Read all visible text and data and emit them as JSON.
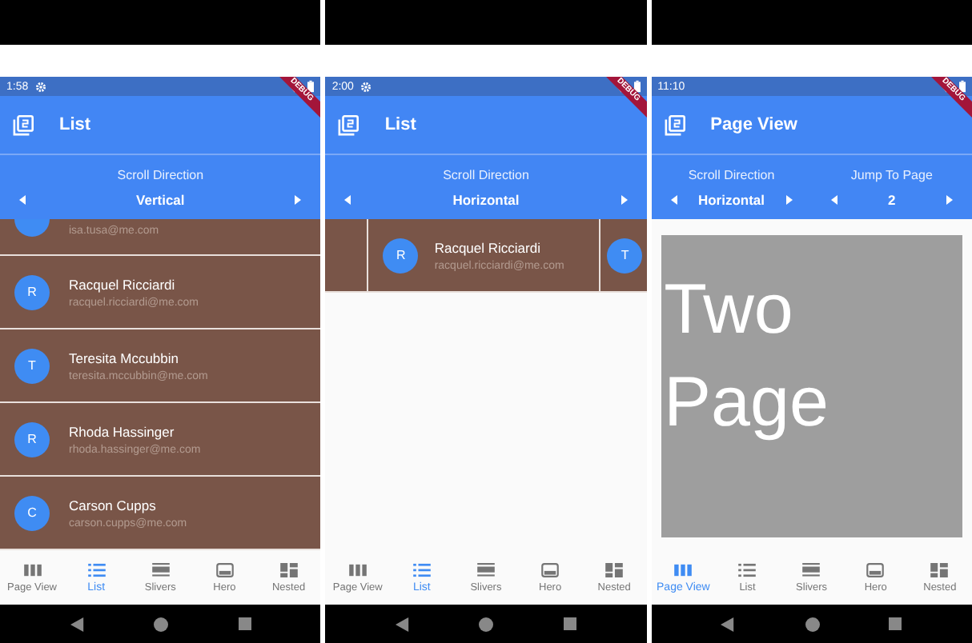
{
  "screens": [
    {
      "status_bar": {
        "time": "1:58",
        "settings_icon": true
      },
      "debug_banner": "DEBUG",
      "app_bar": {
        "title": "List"
      },
      "controls": [
        {
          "label": "Scroll Direction",
          "value": "Vertical"
        }
      ],
      "content": {
        "kind": "vertical_list",
        "items": [
          {
            "email": "isa.tusa@me.com"
          },
          {
            "initial": "R",
            "name": "Racquel Ricciardi",
            "email": "racquel.ricciardi@me.com"
          },
          {
            "initial": "T",
            "name": "Teresita Mccubbin",
            "email": "teresita.mccubbin@me.com"
          },
          {
            "initial": "R",
            "name": "Rhoda Hassinger",
            "email": "rhoda.hassinger@me.com"
          },
          {
            "initial": "C",
            "name": "Carson Cupps",
            "email": "carson.cupps@me.com"
          }
        ]
      },
      "bottom_nav": [
        {
          "label": "Page View",
          "selected": false
        },
        {
          "label": "List",
          "selected": true
        },
        {
          "label": "Slivers",
          "selected": false
        },
        {
          "label": "Hero",
          "selected": false
        },
        {
          "label": "Nested",
          "selected": false
        }
      ]
    },
    {
      "status_bar": {
        "time": "2:00",
        "settings_icon": true
      },
      "debug_banner": "DEBUG",
      "app_bar": {
        "title": "List"
      },
      "controls": [
        {
          "label": "Scroll Direction",
          "value": "Horizontal"
        }
      ],
      "content": {
        "kind": "horizontal_list",
        "items": [
          {
            "initial": "R",
            "name": "Racquel Ricciardi",
            "email": "racquel.ricciardi@me.com"
          },
          {
            "initial": "T"
          }
        ]
      },
      "bottom_nav": [
        {
          "label": "Page View",
          "selected": false
        },
        {
          "label": "List",
          "selected": true
        },
        {
          "label": "Slivers",
          "selected": false
        },
        {
          "label": "Hero",
          "selected": false
        },
        {
          "label": "Nested",
          "selected": false
        }
      ]
    },
    {
      "status_bar": {
        "time": "11:10",
        "settings_icon": false
      },
      "debug_banner": "DEBUG",
      "app_bar": {
        "title": "Page View"
      },
      "controls": [
        {
          "label": "Scroll Direction",
          "value": "Horizontal"
        },
        {
          "label": "Jump To Page",
          "value": "2"
        }
      ],
      "content": {
        "kind": "page",
        "text": "Two Page"
      },
      "bottom_nav": [
        {
          "label": "Page View",
          "selected": true
        },
        {
          "label": "List",
          "selected": false
        },
        {
          "label": "Slivers",
          "selected": false
        },
        {
          "label": "Hero",
          "selected": false
        },
        {
          "label": "Nested",
          "selected": false
        }
      ]
    }
  ]
}
